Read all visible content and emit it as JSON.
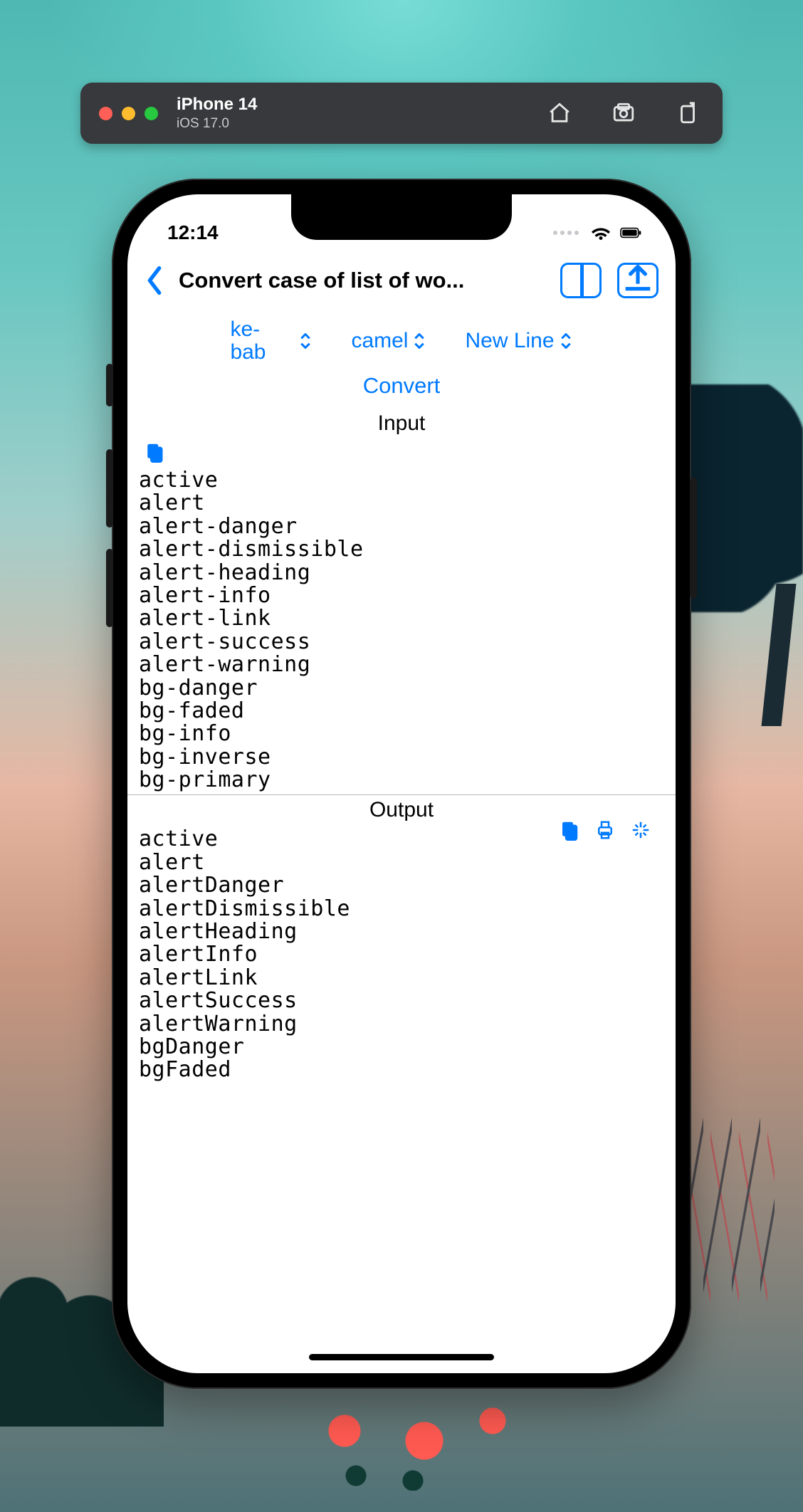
{
  "simulator": {
    "device": "iPhone 14",
    "os": "iOS 17.0"
  },
  "status": {
    "time": "12:14"
  },
  "nav": {
    "title": "Convert case of list of wo..."
  },
  "controls": {
    "from_case": "ke-bab",
    "to_case": "camel",
    "separator": "New Line",
    "convert_label": "Convert"
  },
  "sections": {
    "input_label": "Input",
    "output_label": "Output"
  },
  "input_lines": [
    "active",
    "alert",
    "alert-danger",
    "alert-dismissible",
    "alert-heading",
    "alert-info",
    "alert-link",
    "alert-success",
    "alert-warning",
    "bg-danger",
    "bg-faded",
    "bg-info",
    "bg-inverse",
    "bg-primary"
  ],
  "output_lines": [
    "active",
    "alert",
    "alertDanger",
    "alertDismissible",
    "alertHeading",
    "alertInfo",
    "alertLink",
    "alertSuccess",
    "alertWarning",
    "bgDanger",
    "bgFaded"
  ]
}
